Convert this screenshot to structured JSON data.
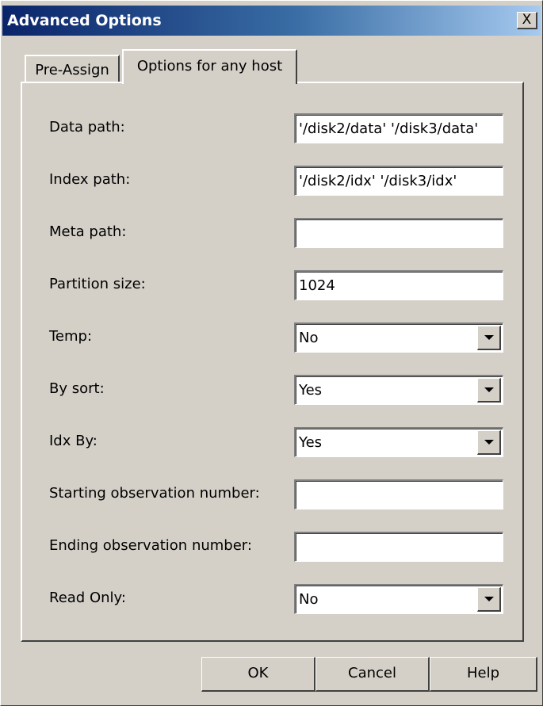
{
  "window": {
    "title": "Advanced Options",
    "close_glyph": "X"
  },
  "tabs": [
    {
      "label": "Pre-Assign",
      "active": false
    },
    {
      "label": "Options for any host",
      "active": true
    }
  ],
  "fields": [
    {
      "label": "Data path:",
      "type": "text",
      "value": "'/disk2/data' '/disk3/data'"
    },
    {
      "label": "Index path:",
      "type": "text",
      "value": "'/disk2/idx' '/disk3/idx'"
    },
    {
      "label": "Meta path:",
      "type": "text",
      "value": ""
    },
    {
      "label": "Partition size:",
      "type": "text",
      "value": "1024"
    },
    {
      "label": "Temp:",
      "type": "select",
      "value": "No"
    },
    {
      "label": "By sort:",
      "type": "select",
      "value": "Yes"
    },
    {
      "label": "Idx By:",
      "type": "select",
      "value": "Yes"
    },
    {
      "label": "Starting observation number:",
      "type": "text",
      "value": ""
    },
    {
      "label": "Ending observation number:",
      "type": "text",
      "value": ""
    },
    {
      "label": "Read Only:",
      "type": "select",
      "value": "No"
    }
  ],
  "buttons": {
    "ok": "OK",
    "cancel": "Cancel",
    "help": "Help"
  },
  "colors": {
    "face": "#d4d0c8",
    "title_start": "#0a246a",
    "title_end": "#a6caf0"
  }
}
